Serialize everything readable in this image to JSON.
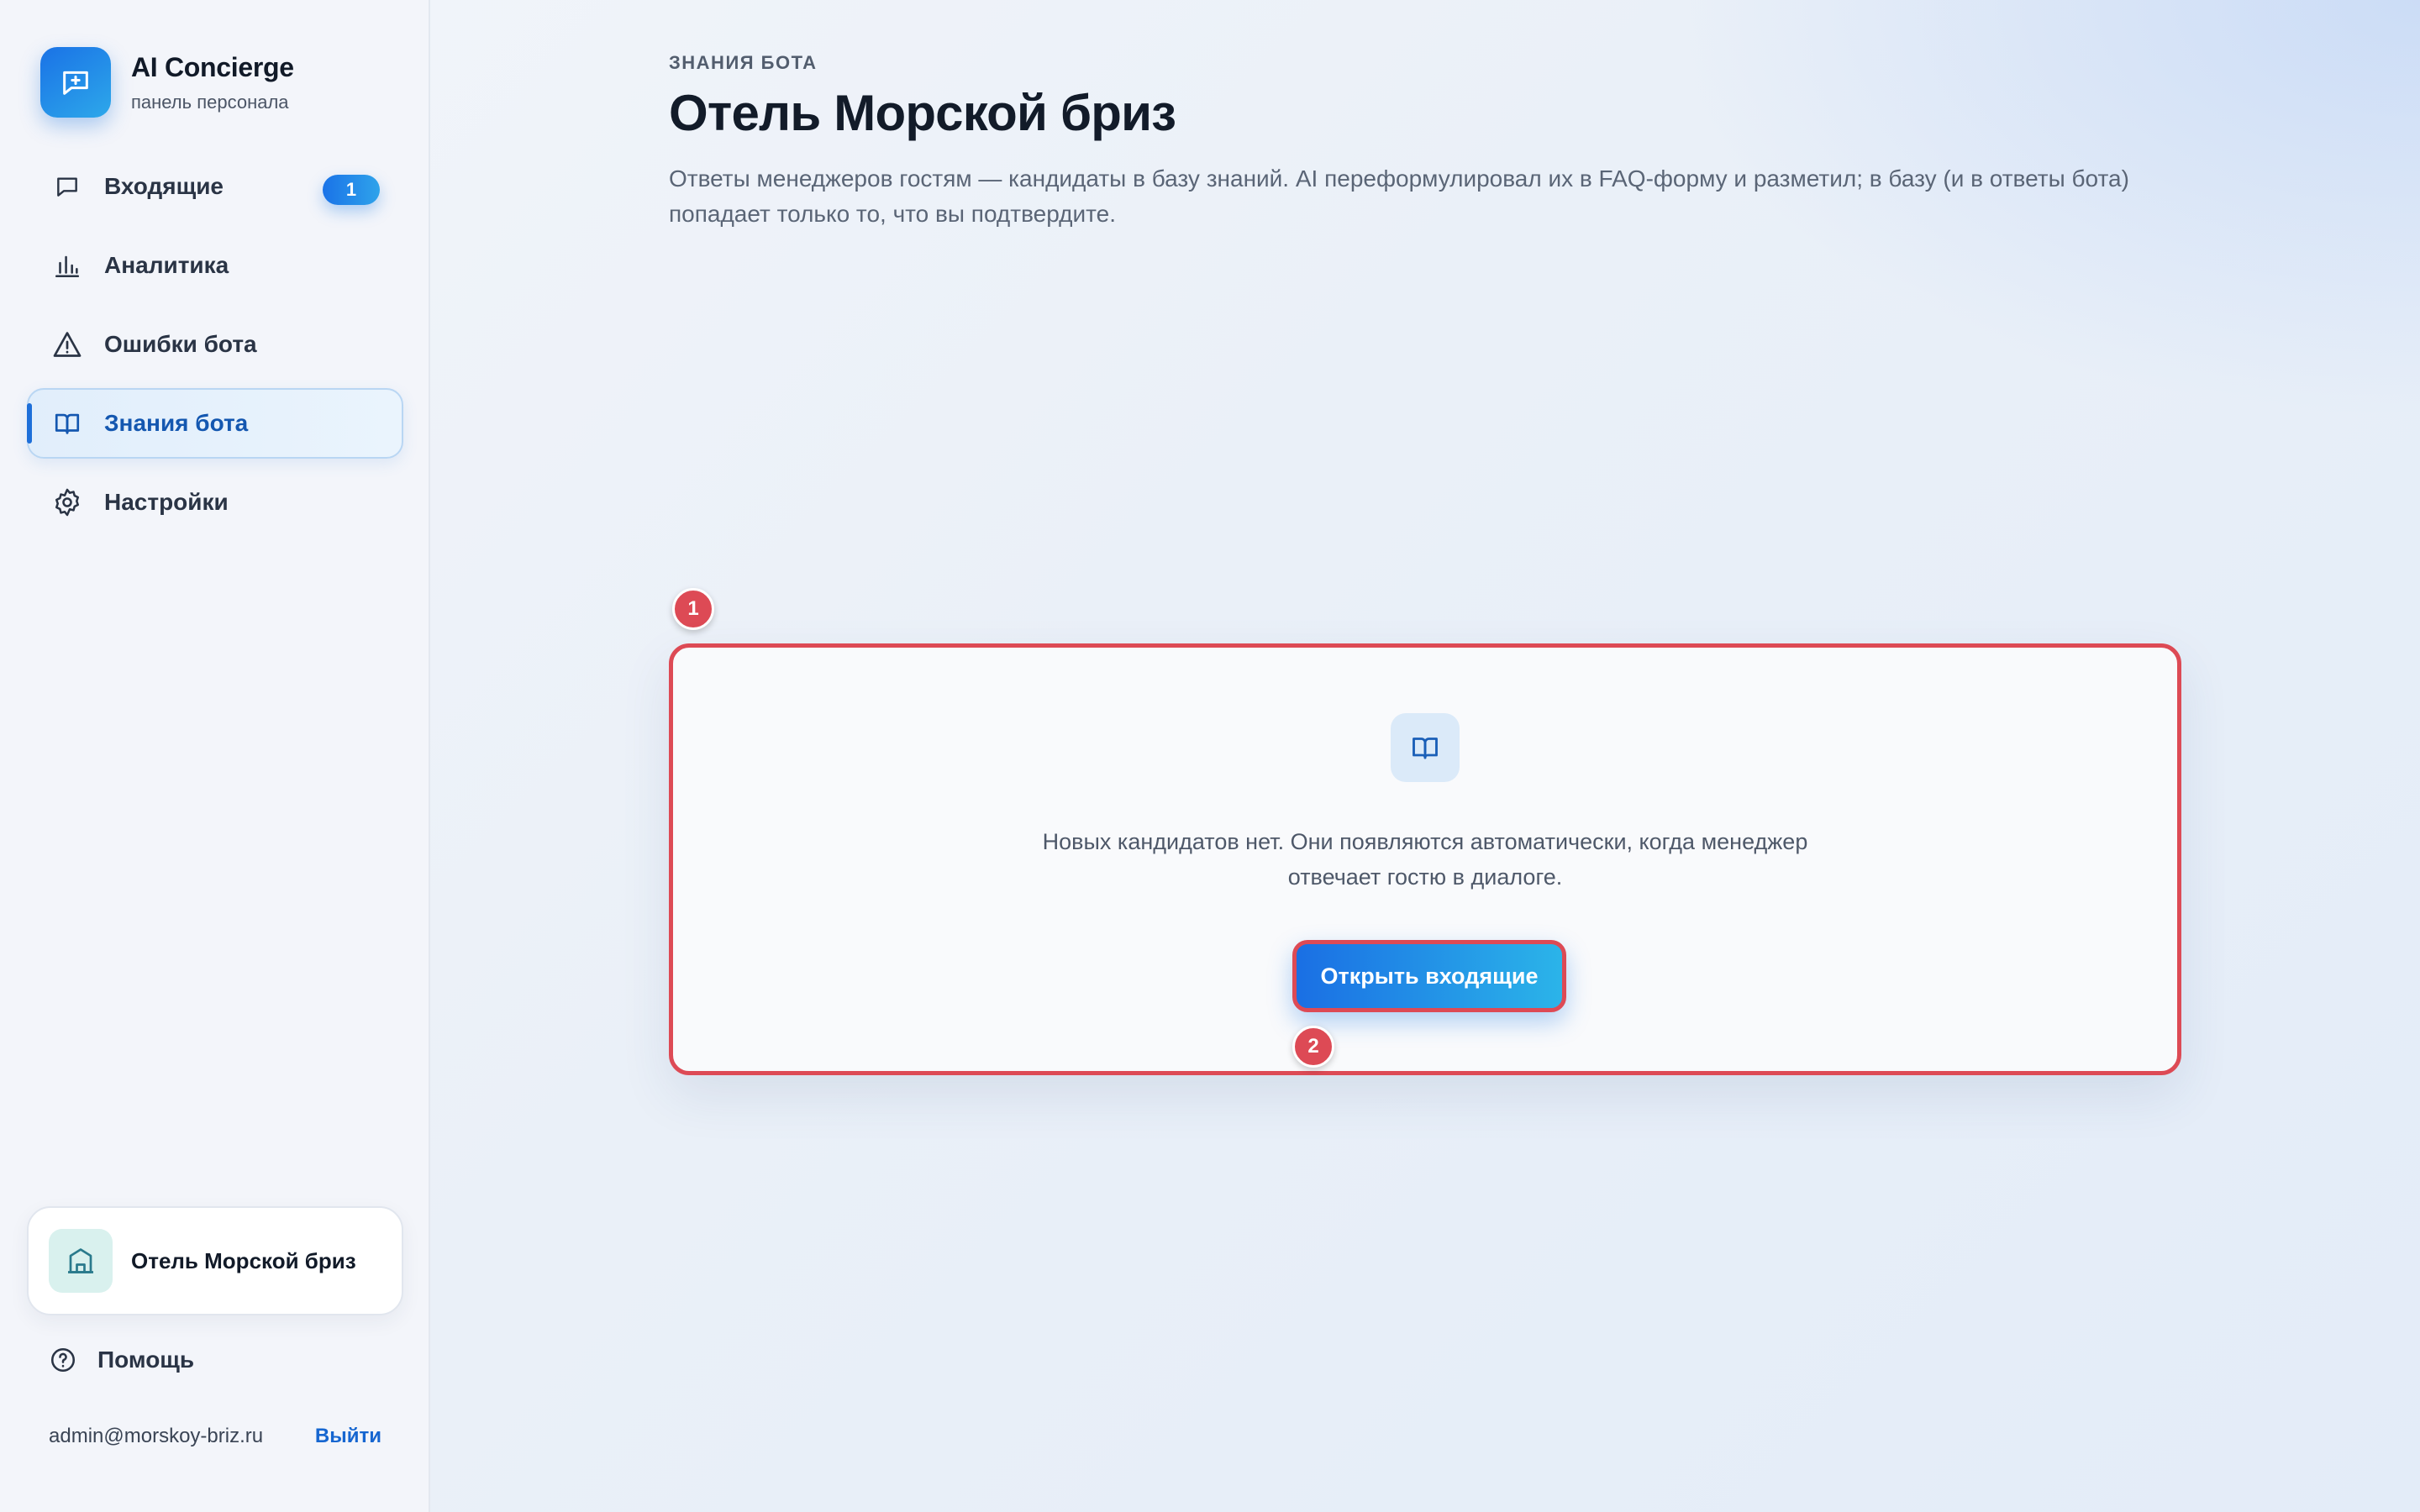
{
  "brand": {
    "title": "AI Concierge",
    "subtitle": "панель персонала",
    "icon": "chat-sparkle-icon"
  },
  "nav": {
    "items": [
      {
        "label": "Входящие",
        "icon": "message-square-icon",
        "badge": "1",
        "active": false
      },
      {
        "label": "Аналитика",
        "icon": "bar-chart-icon",
        "active": false
      },
      {
        "label": "Ошибки бота",
        "icon": "alert-triangle-icon",
        "active": false
      },
      {
        "label": "Знания бота",
        "icon": "book-open-icon",
        "active": true
      },
      {
        "label": "Настройки",
        "icon": "gear-icon",
        "active": false
      }
    ]
  },
  "hotel": {
    "name": "Отель Морской бриз",
    "icon": "building-icon"
  },
  "help": {
    "label": "Помощь",
    "icon": "help-circle-icon"
  },
  "account": {
    "email": "admin@morskoy-briz.ru",
    "logout_label": "Выйти"
  },
  "main": {
    "eyebrow": "ЗНАНИЯ БОТА",
    "title": "Отель Морской бриз",
    "description": "Ответы менеджеров гостям — кандидаты в базу знаний. AI переформулировал их в FAQ-форму и разметил; в базу (и в ответы бота) попадает только то, что вы подтвердите.",
    "empty_state": {
      "icon": "book-open-icon",
      "text": "Новых кандидатов нет. Они появляются автоматически, когда менеджер отвечает гостю в диалоге.",
      "button_label": "Открыть входящие"
    }
  },
  "annotations": {
    "marker_1": "1",
    "marker_2": "2"
  },
  "colors": {
    "accent": "#1e6fd9",
    "highlight": "#dd4a55",
    "sidebar_bg": "#f3f5fa"
  }
}
